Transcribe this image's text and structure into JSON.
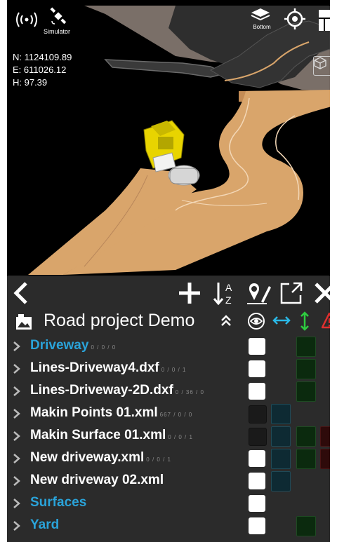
{
  "status": {
    "signal_icon": "signal-broadcast-icon",
    "satellite_icon": "satellite-icon",
    "simulator_label": "Simulator",
    "layers_label": "Bottom"
  },
  "coords": {
    "north": "N: 1124109.89",
    "east": "E: 611026.12",
    "height": "H: 97.39"
  },
  "project": {
    "title": "Road project Demo"
  },
  "items": [
    {
      "name": "Driveway",
      "counts": "0 / 0 / 0",
      "folder": true
    },
    {
      "name": "Lines-Driveway4.dxf",
      "counts": "0 / 0 / 1",
      "folder": false
    },
    {
      "name": "Lines-Driveway-2D.dxf",
      "counts": "0 / 36 / 0",
      "folder": false
    },
    {
      "name": "Makin Points 01.xml",
      "counts": "667 / 0 / 0",
      "folder": false
    },
    {
      "name": "Makin Surface 01.xml",
      "counts": "0 / 0 / 1",
      "folder": false
    },
    {
      "name": "New driveway.xml",
      "counts": "0 / 0 / 1",
      "folder": false
    },
    {
      "name": "New driveway 02.xml",
      "counts": "",
      "folder": false
    },
    {
      "name": "Surfaces",
      "counts": "",
      "folder": true
    },
    {
      "name": "Yard",
      "counts": "",
      "folder": true
    }
  ],
  "colors": {
    "folder": "#2aa3d9",
    "panel": "#2b2b2b",
    "road": "#d9a56b",
    "machine": "#e8d400"
  }
}
